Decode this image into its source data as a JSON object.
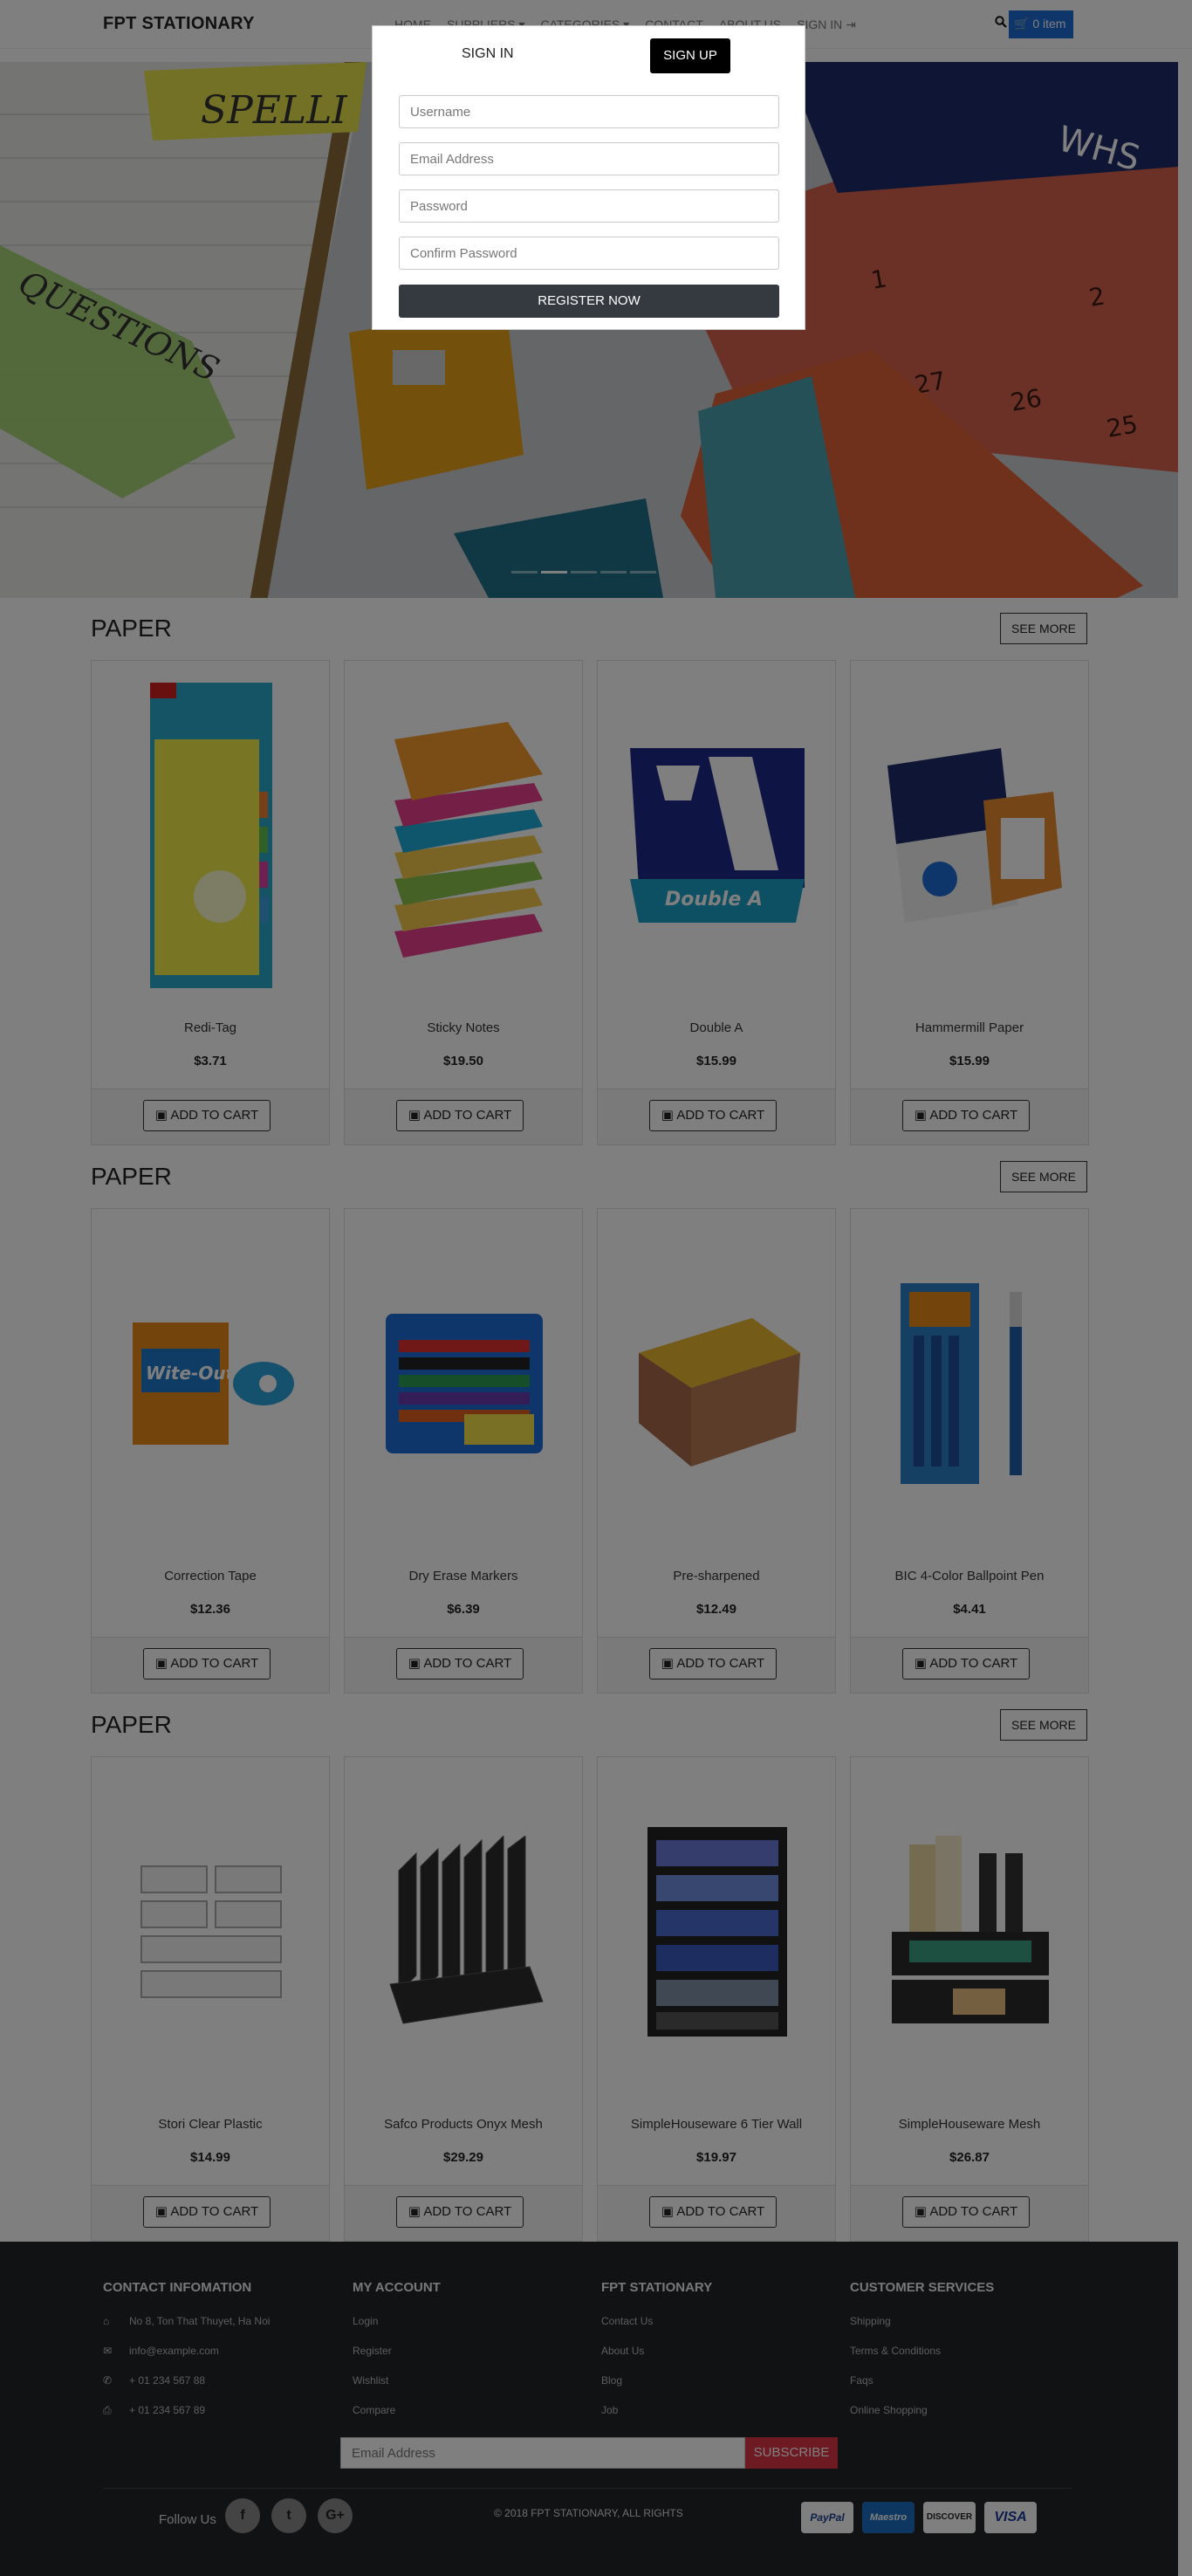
{
  "navbar": {
    "brand": "FPT STATIONARY",
    "links": [
      "Home",
      "Suppliers ▾",
      "Categories ▾",
      "Contact",
      "About us",
      "Sign in"
    ],
    "cart_label": "0 item"
  },
  "sections": [
    {
      "title": "PAPER",
      "see_more": "SEE MORE",
      "products": [
        {
          "name": "Redi-Tag",
          "price": "$3.71",
          "cta": "ADD TO CART"
        },
        {
          "name": "Sticky Notes",
          "price": "$19.50",
          "cta": "ADD TO CART"
        },
        {
          "name": "Double A",
          "price": "$15.99",
          "cta": "ADD TO CART"
        },
        {
          "name": "Hammermill Paper",
          "price": "$15.99",
          "cta": "ADD TO CART"
        }
      ]
    },
    {
      "title": "PAPER",
      "see_more": "SEE MORE",
      "products": [
        {
          "name": "Correction Tape",
          "price": "$12.36",
          "cta": "ADD TO CART"
        },
        {
          "name": "Dry Erase Markers",
          "price": "$6.39",
          "cta": "ADD TO CART"
        },
        {
          "name": "Pre-sharpened",
          "price": "$12.49",
          "cta": "ADD TO CART"
        },
        {
          "name": "BIC 4-Color Ballpoint Pen",
          "price": "$4.41",
          "cta": "ADD TO CART"
        }
      ]
    },
    {
      "title": "PAPER",
      "see_more": "SEE MORE",
      "products": [
        {
          "name": "Stori Clear Plastic",
          "price": "$14.99",
          "cta": "ADD TO CART"
        },
        {
          "name": "Safco Products Onyx Mesh",
          "price": "$29.29",
          "cta": "ADD TO CART"
        },
        {
          "name": "SimpleHouseware 6 Tier Wall",
          "price": "$19.97",
          "cta": "ADD TO CART"
        },
        {
          "name": "SimpleHouseware Mesh",
          "price": "$26.87",
          "cta": "ADD TO CART"
        }
      ]
    }
  ],
  "footer": {
    "contact": {
      "title": "CONTACT INFOMATION",
      "address": "No 8, Ton That Thuyet, Ha Noi",
      "email": "info@example.com",
      "phone": "+ 01 234 567 88",
      "fax": "+ 01 234 567 89"
    },
    "account": {
      "title": "MY ACCOUNT",
      "items": [
        "Login",
        "Register",
        "Wishlist",
        "Compare"
      ]
    },
    "company": {
      "title": "FPT STATIONARY",
      "items": [
        "Contact Us",
        "About Us",
        "Blog",
        "Job"
      ]
    },
    "services": {
      "title": "CUSTOMER SERVICES",
      "items": [
        "Shipping",
        "Terms & Conditions",
        "Faqs",
        "Online Shopping"
      ]
    },
    "newsletter": {
      "placeholder": "Email Address",
      "button": "SUBSCRIBE"
    },
    "follow_us": "Follow Us",
    "copyright": "© 2018 FPT STATIONARY, ALL RIGHTS",
    "payments": [
      "PayPal",
      "Maestro",
      "DISCOVER",
      "VISA"
    ]
  },
  "modal": {
    "tab_signin": "SIGN IN",
    "tab_signup": "SIGN UP",
    "username_placeholder": "Username",
    "email_placeholder": "Email Address",
    "password_placeholder": "Password",
    "confirm_placeholder": "Confirm Password",
    "submit": "REGISTER NOW"
  },
  "colors": {
    "accent": "#1f6dd4",
    "subscribe": "#dc3545",
    "footer_bg": "#212529"
  },
  "icons": [
    "search-icon",
    "cart-icon",
    "signin-icon",
    "shopping-bag-icon",
    "home-icon",
    "envelope-icon",
    "phone-icon",
    "fax-icon",
    "facebook-icon",
    "twitter-icon",
    "google-plus-icon"
  ]
}
